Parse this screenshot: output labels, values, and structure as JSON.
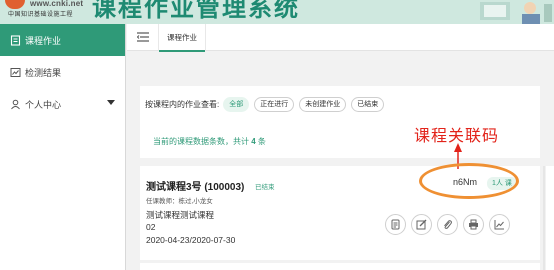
{
  "header": {
    "logo_url": "www.cnki.net",
    "logo_subtitle": "中国知识基础设施工程",
    "app_title": "课程作业管理系统"
  },
  "sidebar": {
    "items": [
      {
        "label": "课程作业",
        "icon": "assignment-icon",
        "active": true
      },
      {
        "label": "检测结果",
        "icon": "chart-icon",
        "active": false
      },
      {
        "label": "个人中心",
        "icon": "user-icon",
        "active": false,
        "expandable": true
      }
    ]
  },
  "tabbar": {
    "tabs": [
      {
        "label": "课程作业",
        "active": true
      }
    ]
  },
  "filter": {
    "label": "按课程内的作业查看:",
    "options": [
      {
        "label": "全部",
        "active": true
      },
      {
        "label": "正在进行",
        "active": false
      },
      {
        "label": "未创建作业",
        "active": false
      },
      {
        "label": "已结束",
        "active": false
      }
    ],
    "count_prefix": "当前的课程数据条数，共计",
    "count_value": "4",
    "count_suffix": "条"
  },
  "annotation": {
    "text": "课程关联码"
  },
  "course_card": {
    "title": "测试课程3号 (100003)",
    "status": "已结束",
    "teacher": "任课教师：栋过,小龙女",
    "description": "测试课程测试课程",
    "code": "02",
    "dates": "2020-04-23/2020-07-30",
    "join_code": "n6Nm",
    "people_badge": "1人  课",
    "actions": [
      "document-icon",
      "edit-icon",
      "attachment-icon",
      "print-icon",
      "stats-icon"
    ]
  },
  "colors": {
    "primary": "#2f9a78",
    "header_bg": "#cfe8df",
    "annotation_red": "#e2231a",
    "annotation_orange": "#ef9033"
  }
}
